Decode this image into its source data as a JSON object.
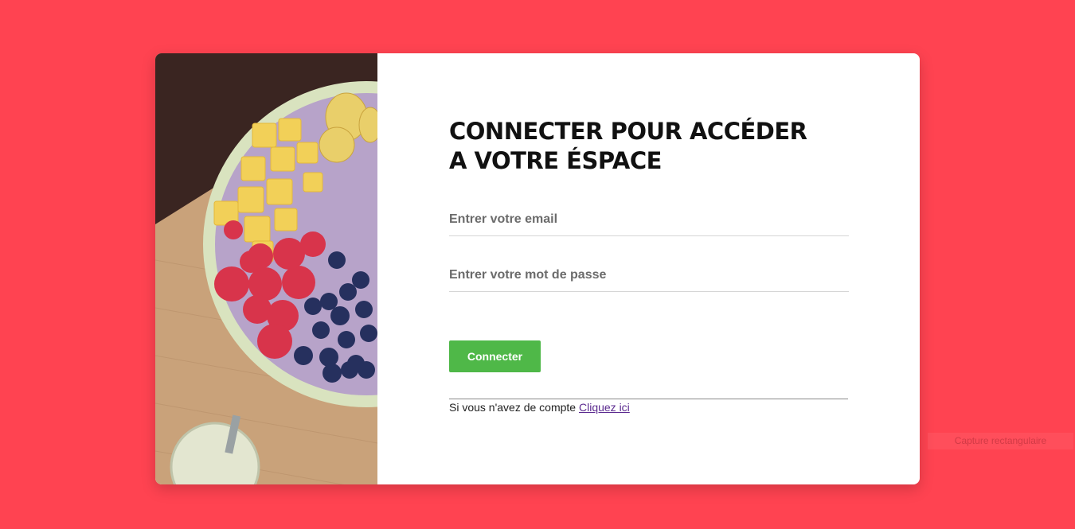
{
  "login": {
    "title": "CONNECTER POUR ACCÉDER A VOTRE ÉSPACE",
    "email_placeholder": "Entrer votre email",
    "password_placeholder": "Entrer votre mot de passe",
    "submit_label": "Connecter",
    "signup_prompt": "Si vous n'avez de compte",
    "signup_link": "Cliquez ici"
  },
  "overlay": {
    "capture_label": "Capture rectangulaire"
  },
  "colors": {
    "background": "#ff4351",
    "button": "#4fb848",
    "link": "#5b2a8f"
  },
  "image": {
    "subject": "smoothie-bowl-photo"
  }
}
